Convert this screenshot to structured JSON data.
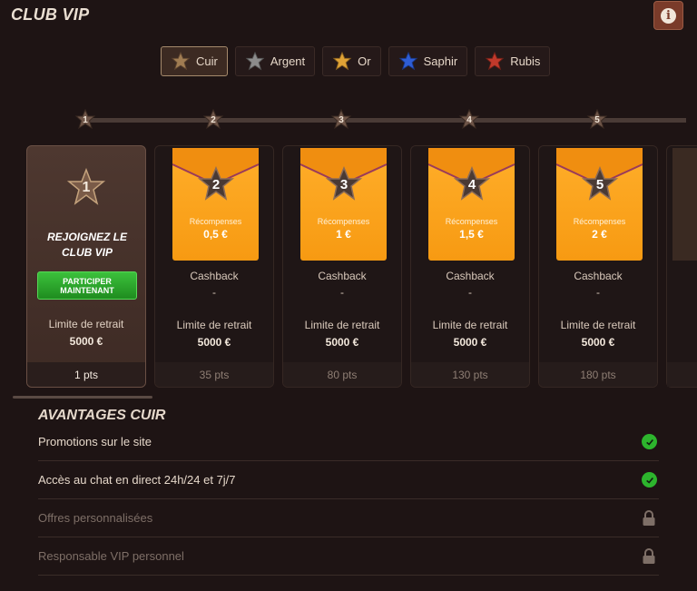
{
  "header": {
    "title": "CLUB VIP",
    "info_label": "i"
  },
  "tiers": [
    {
      "label": "Cuir",
      "color": "#a07c52",
      "active": true
    },
    {
      "label": "Argent",
      "color": "#8c8c8c",
      "active": false
    },
    {
      "label": "Or",
      "color": "#e0a336",
      "active": false
    },
    {
      "label": "Saphir",
      "color": "#2e5dd4",
      "active": false
    },
    {
      "label": "Rubis",
      "color": "#c0392b",
      "active": false
    }
  ],
  "track_levels": [
    "1",
    "2",
    "3",
    "4",
    "5"
  ],
  "join_card": {
    "level": "1",
    "title": "REJOIGNEZ LE CLUB VIP",
    "button_label": "PARTICIPER MAINTENANT",
    "limit_label": "Limite de retrait",
    "limit_value": "5000 €",
    "points": "1 pts"
  },
  "levels": [
    {
      "level": "2",
      "reward_label": "Récompenses",
      "reward_amount": "0,5 €",
      "cashback_label": "Cashback",
      "cashback_value": "-",
      "limit_label": "Limite de retrait",
      "limit_value": "5000 €",
      "points": "35 pts"
    },
    {
      "level": "3",
      "reward_label": "Récompenses",
      "reward_amount": "1 €",
      "cashback_label": "Cashback",
      "cashback_value": "-",
      "limit_label": "Limite de retrait",
      "limit_value": "5000 €",
      "points": "80 pts"
    },
    {
      "level": "4",
      "reward_label": "Récompenses",
      "reward_amount": "1,5 €",
      "cashback_label": "Cashback",
      "cashback_value": "-",
      "limit_label": "Limite de retrait",
      "limit_value": "5000 €",
      "points": "130 pts"
    },
    {
      "level": "5",
      "reward_label": "Récompenses",
      "reward_amount": "2 €",
      "cashback_label": "Cashback",
      "cashback_value": "-",
      "limit_label": "Limite de retrait",
      "limit_value": "5000 €",
      "points": "180 pts"
    }
  ],
  "advantages": {
    "title": "AVANTAGES CUIR",
    "items": [
      {
        "label": "Promotions sur le site",
        "status": "check-icon"
      },
      {
        "label": "Accès au chat en direct 24h/24 et 7j/7",
        "status": "check-icon"
      },
      {
        "label": "Offres personnalisées",
        "status": "lock-icon"
      },
      {
        "label": "Responsable VIP personnel",
        "status": "lock-icon"
      }
    ]
  },
  "colors": {
    "accent_orange": "#f7a21a",
    "join_green": "#2fa52f",
    "background": "#1e1414"
  }
}
